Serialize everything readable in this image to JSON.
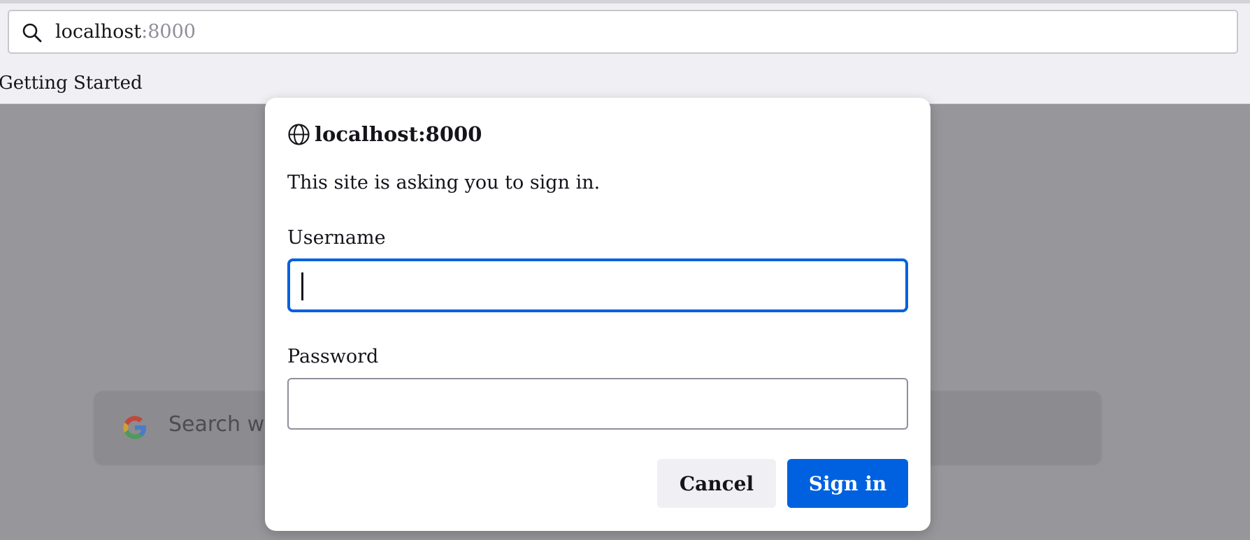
{
  "browser": {
    "url_host": "localhost",
    "url_port": ":8000",
    "bookmarks": [
      {
        "label": "Getting Started"
      }
    ]
  },
  "background_page": {
    "search_placeholder": "Search w"
  },
  "dialog": {
    "title": "localhost:8000",
    "message": "This site is asking you to sign in.",
    "username_label": "Username",
    "username_value": "",
    "password_label": "Password",
    "password_value": "",
    "cancel_label": "Cancel",
    "signin_label": "Sign in"
  },
  "icons": {
    "urlbar": "search-icon",
    "dialog_header": "globe-icon",
    "page_search": "google-icon"
  },
  "colors": {
    "accent": "#0061e0",
    "overlay": "#97969b",
    "chrome": "#f0f0f4"
  }
}
